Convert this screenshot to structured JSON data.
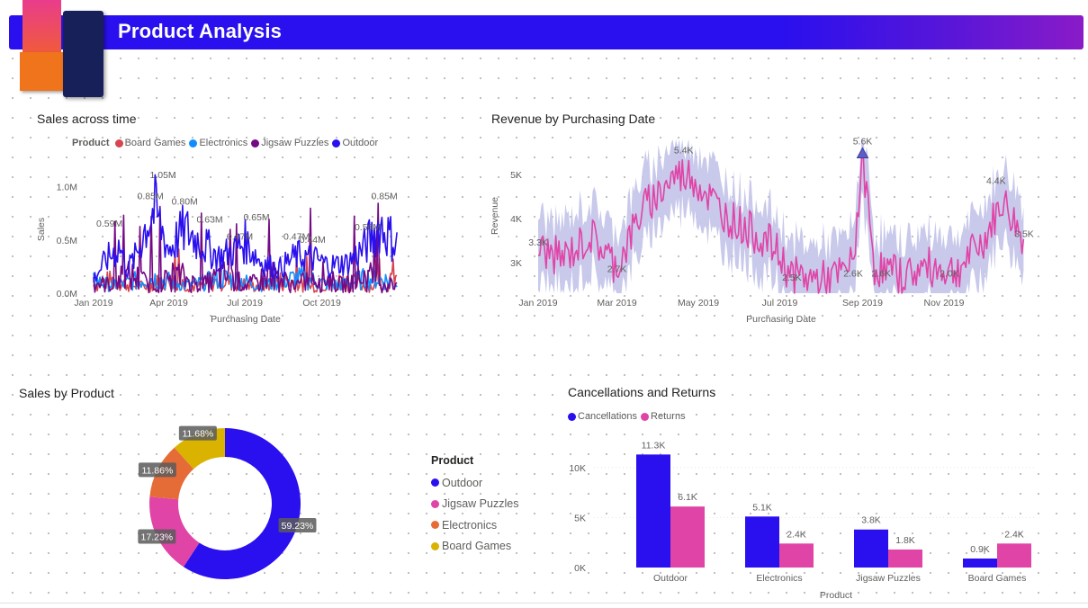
{
  "header": {
    "title": "Product Analysis"
  },
  "visuals": {
    "sales_time_title": "Sales across time",
    "revenue_title": "Revenue by Purchasing Date",
    "sales_product_title": "Sales by Product",
    "cancel_title": "Cancellations and Returns"
  },
  "colors": {
    "banner": "#2a10ee",
    "outdoor": "#2a10ee",
    "jigsaw": "#e044a7",
    "electronics": "#e66c37",
    "board_games": "#d9b300",
    "ts_board_games": "#d64550",
    "ts_electronics": "#118dff",
    "ts_jigsaw": "#750985",
    "revenue_line": "#e044a7",
    "revenue_band": "#c5c6ea"
  },
  "chart_data": [
    {
      "id": "sales_across_time",
      "type": "line",
      "title": "Sales across time",
      "xlabel": "Purchasing Date",
      "ylabel": "Sales",
      "x_range": [
        "2019-01-01",
        "2019-12-31"
      ],
      "ylim": [
        0,
        1150000
      ],
      "x_ticks": [
        "Jan 2019",
        "Apr 2019",
        "Jul 2019",
        "Oct 2019"
      ],
      "y_ticks": [
        "0.0M",
        "0.5M",
        "1.0M"
      ],
      "legend_title": "Product",
      "legend_position": "top",
      "series": [
        {
          "name": "Board Games",
          "color": "#d64550"
        },
        {
          "name": "Electronics",
          "color": "#118dff"
        },
        {
          "name": "Jigsaw Puzzles",
          "color": "#750985"
        },
        {
          "name": "Outdoor",
          "color": "#2a10ee"
        }
      ],
      "outdoor_anchors": [
        [
          "2019-01-01",
          0.18
        ],
        [
          "2019-01-15",
          0.4
        ],
        [
          "2019-02-01",
          0.59
        ],
        [
          "2019-02-10",
          0.3
        ],
        [
          "2019-02-20",
          0.45
        ],
        [
          "2019-03-05",
          0.85
        ],
        [
          "2019-03-15",
          1.05
        ],
        [
          "2019-04-01",
          0.55
        ],
        [
          "2019-04-20",
          0.8
        ],
        [
          "2019-05-10",
          0.63
        ],
        [
          "2019-06-01",
          0.45
        ],
        [
          "2019-06-20",
          0.55
        ],
        [
          "2019-07-01",
          0.65
        ],
        [
          "2019-07-20",
          0.4
        ],
        [
          "2019-08-10",
          0.3
        ],
        [
          "2019-09-01",
          0.47
        ],
        [
          "2019-09-20",
          0.44
        ],
        [
          "2019-10-10",
          0.35
        ],
        [
          "2019-11-01",
          0.38
        ],
        [
          "2019-11-20",
          0.56
        ],
        [
          "2019-12-10",
          0.85
        ],
        [
          "2019-12-31",
          0.6
        ]
      ],
      "labels": [
        {
          "x": "2019-01-20",
          "y": 0.59,
          "text": "0.59M"
        },
        {
          "x": "2019-03-10",
          "y": 0.85,
          "text": "0.85M"
        },
        {
          "x": "2019-03-25",
          "y": 1.05,
          "text": "1.05M"
        },
        {
          "x": "2019-04-20",
          "y": 0.8,
          "text": "0.80M"
        },
        {
          "x": "2019-05-20",
          "y": 0.63,
          "text": "0.63M"
        },
        {
          "x": "2019-07-15",
          "y": 0.65,
          "text": "0.65M"
        },
        {
          "x": "2019-06-25",
          "y": 0.47,
          "text": "0.47M"
        },
        {
          "x": "2019-09-01",
          "y": 0.47,
          "text": "0.47M"
        },
        {
          "x": "2019-09-20",
          "y": 0.44,
          "text": "0.44M"
        },
        {
          "x": "2019-11-25",
          "y": 0.56,
          "text": "0.56M"
        },
        {
          "x": "2019-12-15",
          "y": 0.85,
          "text": "0.85M"
        }
      ]
    },
    {
      "id": "revenue_by_date",
      "type": "area",
      "title": "Revenue by Purchasing Date",
      "xlabel": "Purchasing Date",
      "ylabel": "Revenue",
      "x_range": [
        "2019-01-01",
        "2019-12-31"
      ],
      "ylim": [
        2300,
        5900
      ],
      "x_ticks": [
        "Jan 2019",
        "Mar 2019",
        "May 2019",
        "Jul 2019",
        "Sep 2019",
        "Nov 2019"
      ],
      "y_ticks": [
        "3K",
        "4K",
        "5K"
      ],
      "anchors": [
        [
          "2019-01-01",
          3300
        ],
        [
          "2019-01-20",
          3100
        ],
        [
          "2019-02-10",
          3600
        ],
        [
          "2019-03-01",
          2900
        ],
        [
          "2019-03-20",
          4200
        ],
        [
          "2019-04-05",
          4700
        ],
        [
          "2019-04-20",
          5200
        ],
        [
          "2019-05-01",
          4800
        ],
        [
          "2019-05-20",
          4100
        ],
        [
          "2019-06-10",
          3700
        ],
        [
          "2019-06-25",
          3400
        ],
        [
          "2019-07-10",
          2700
        ],
        [
          "2019-08-01",
          2600
        ],
        [
          "2019-08-15",
          2700
        ],
        [
          "2019-08-25",
          3000
        ],
        [
          "2019-09-01",
          5400
        ],
        [
          "2019-09-10",
          2900
        ],
        [
          "2019-10-01",
          2700
        ],
        [
          "2019-10-20",
          2900
        ],
        [
          "2019-11-10",
          2800
        ],
        [
          "2019-12-01",
          3500
        ],
        [
          "2019-12-15",
          4400
        ],
        [
          "2019-12-31",
          3500
        ]
      ],
      "anomaly": {
        "x": "2019-09-01",
        "y": 5400
      },
      "labels": [
        {
          "x": "2019-01-01",
          "y": 3300,
          "text": "3.3K"
        },
        {
          "x": "2019-03-01",
          "y": 2700,
          "text": "2.7K"
        },
        {
          "x": "2019-04-20",
          "y": 5400,
          "text": "5.4K"
        },
        {
          "x": "2019-07-10",
          "y": 2500,
          "text": "2.5K"
        },
        {
          "x": "2019-08-25",
          "y": 2600,
          "text": "2.6K"
        },
        {
          "x": "2019-09-01",
          "y": 5600,
          "text": "5.6K"
        },
        {
          "x": "2019-09-15",
          "y": 2600,
          "text": "2.6K"
        },
        {
          "x": "2019-11-05",
          "y": 2600,
          "text": "2.0K"
        },
        {
          "x": "2019-12-10",
          "y": 4700,
          "text": "4.4K"
        },
        {
          "x": "2019-12-31",
          "y": 3500,
          "text": "3.5K"
        }
      ]
    },
    {
      "id": "sales_by_product",
      "type": "pie",
      "title": "Sales by Product",
      "legend_title": "Product",
      "legend_position": "right",
      "slices": [
        {
          "name": "Outdoor",
          "value": 59.23,
          "label": "59.23%",
          "color": "#2a10ee"
        },
        {
          "name": "Jigsaw Puzzles",
          "value": 17.23,
          "label": "17.23%",
          "color": "#e044a7"
        },
        {
          "name": "Electronics",
          "value": 11.86,
          "label": "11.86%",
          "color": "#e66c37"
        },
        {
          "name": "Board Games",
          "value": 11.68,
          "label": "11.68%",
          "color": "#d9b300"
        }
      ]
    },
    {
      "id": "cancellations_returns",
      "type": "bar",
      "title": "Cancellations and Returns",
      "xlabel": "Product",
      "ylabel": "",
      "ylim": [
        0,
        12500
      ],
      "y_ticks": [
        "0K",
        "5K",
        "10K"
      ],
      "categories": [
        "Outdoor",
        "Electronics",
        "Jigsaw Puzzles",
        "Board Games"
      ],
      "legend_position": "top-left",
      "series": [
        {
          "name": "Cancellations",
          "color": "#2a10ee",
          "values": [
            11300,
            5100,
            3800,
            900
          ],
          "labels": [
            "11.3K",
            "5.1K",
            "3.8K",
            "0.9K"
          ]
        },
        {
          "name": "Returns",
          "color": "#e044a7",
          "values": [
            6100,
            2400,
            1800,
            2400
          ],
          "labels": [
            "6.1K",
            "2.4K",
            "1.8K",
            "2.4K"
          ]
        }
      ]
    }
  ]
}
